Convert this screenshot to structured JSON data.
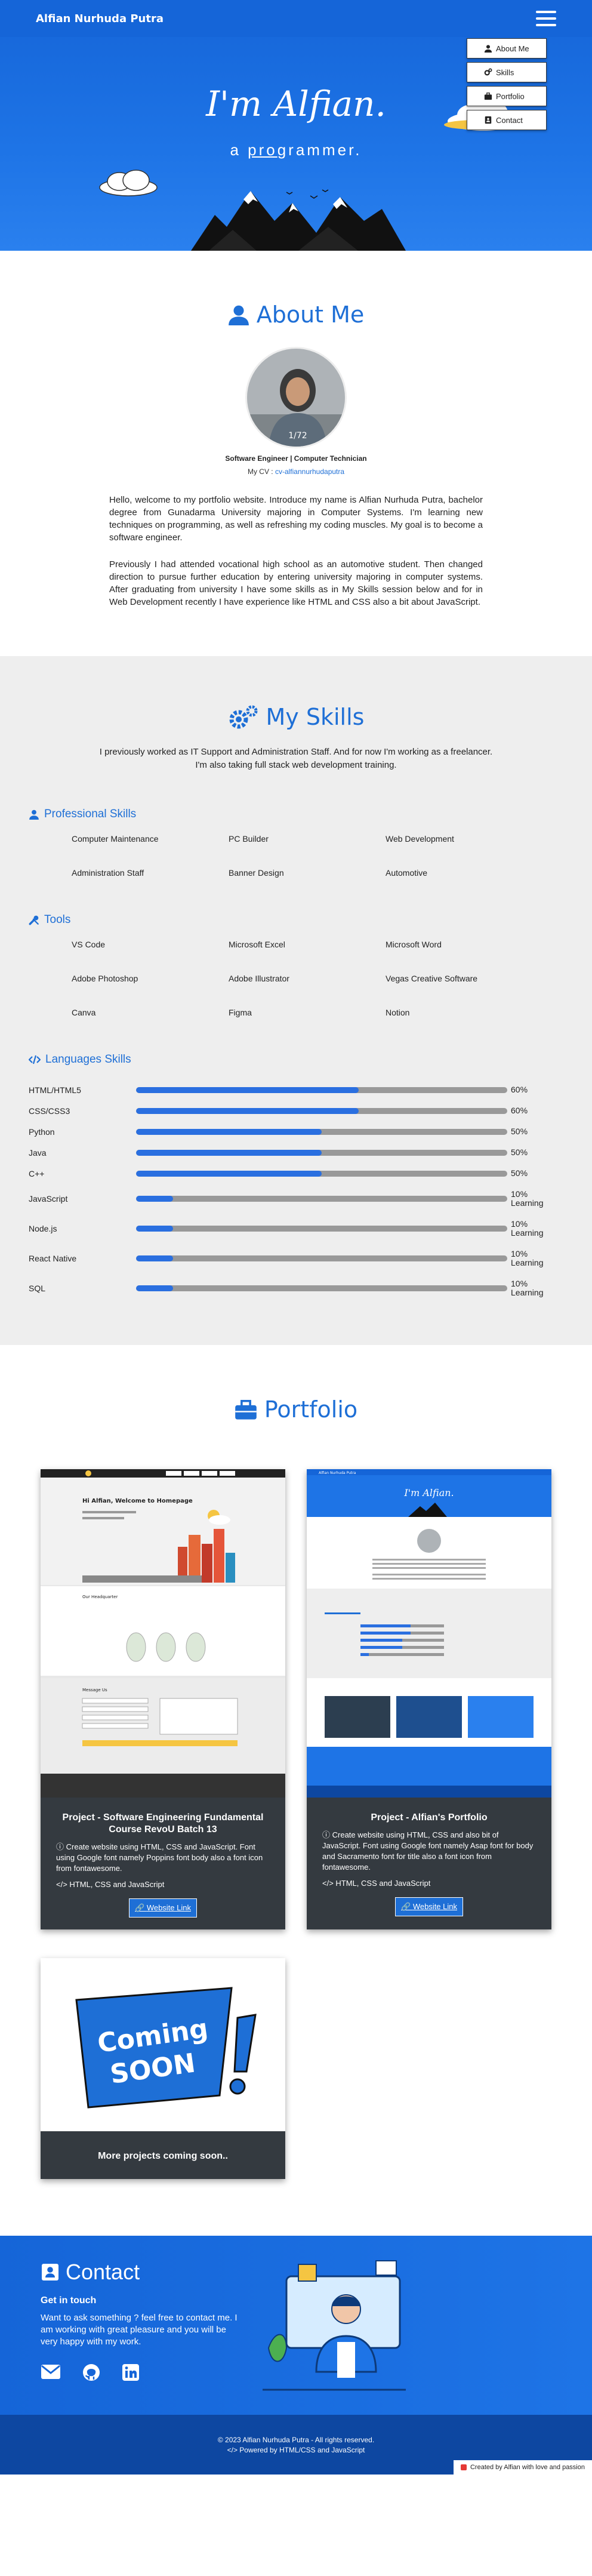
{
  "nav": {
    "brand": "Alfian Nurhuda Putra"
  },
  "menu": {
    "items": [
      {
        "label": "About Me",
        "icon": "user-icon"
      },
      {
        "label": "Skills",
        "icon": "gears-icon"
      },
      {
        "label": "Portfolio",
        "icon": "briefcase-icon"
      },
      {
        "label": "Contact",
        "icon": "contact-card-icon"
      }
    ]
  },
  "hero": {
    "title": "I'm Alfian.",
    "sub_prefix": "a ",
    "sub_underline": "pro",
    "sub_suffix": "grammer."
  },
  "about": {
    "title": "About Me",
    "role": "Software Engineer | Computer Technician",
    "cv_label": "My CV :",
    "cv_link": "cv-alfiannurhudaputra",
    "p1": "Hello, welcome to my portfolio website. Introduce my name is Alfian Nurhuda Putra, bachelor degree from Gunadarma University majoring in Computer Systems. I'm learning new techniques on programming, as well as refreshing my coding muscles. My goal is to become a software engineer.",
    "p2": "Previously I had attended vocational high school as an automotive student. Then changed direction to pursue further education by entering university majoring in computer systems. After graduating from university I have some skills as in My Skills session below and for in Web Development recently I have experience like HTML and CSS also a bit about JavaScript."
  },
  "skills": {
    "title": "My Skills",
    "intro1": "I previously worked as IT Support and Administration Staff. And for now I'm working as a freelancer.",
    "intro2": "I'm also taking full stack web development training.",
    "professional_title": "Professional Skills",
    "professional": [
      "Computer Maintenance",
      "PC Builder",
      "Web Development",
      "Administration Staff",
      "Banner Design",
      "Automotive"
    ],
    "tools_title": "Tools",
    "tools": [
      "VS Code",
      "Microsoft Excel",
      "Microsoft Word",
      "Adobe Photoshop",
      "Adobe Illustrator",
      "Vegas Creative Software",
      "Canva",
      "Figma",
      "Notion"
    ],
    "languages_title": "Languages Skills",
    "languages": [
      {
        "name": "HTML/HTML5",
        "level": 60,
        "label": "60%"
      },
      {
        "name": "CSS/CSS3",
        "level": 60,
        "label": "60%"
      },
      {
        "name": "Python",
        "level": 50,
        "label": "50%"
      },
      {
        "name": "Java",
        "level": 50,
        "label": "50%"
      },
      {
        "name": "C++",
        "level": 50,
        "label": "50%"
      },
      {
        "name": "JavaScript",
        "level": 10,
        "label": "10% Learning"
      },
      {
        "name": "Node.js",
        "level": 10,
        "label": "10% Learning"
      },
      {
        "name": "React Native",
        "level": 10,
        "label": "10% Learning"
      },
      {
        "name": "SQL",
        "level": 10,
        "label": "10% Learning"
      }
    ]
  },
  "portfolio": {
    "title": "Portfolio",
    "projects": [
      {
        "title": "Project - Software Engineering Fundamental Course RevoU Batch 13",
        "desc": "Create website using HTML, CSS and JavaScript. Font using Google font namely Poppins font body also a font icon from fontawesome.",
        "tech": "HTML, CSS and JavaScript",
        "button": "Website Link"
      },
      {
        "title": "Project - Alfian's Portfolio",
        "desc": "Create website using HTML, CSS and also bit of JavaScript. Font using Google font namely Asap font for body and Sacramento font for title also a font icon from fontawesome.",
        "tech": "HTML, CSS and JavaScript",
        "button": "Website Link"
      }
    ],
    "coming": {
      "title": "More projects coming soon..",
      "art_l1": "Coming",
      "art_l2": "SOON"
    },
    "shot1": {
      "headline": "Hi Alfian, Welcome to Homepage",
      "section": "Our Headquarter",
      "form": "Message Us"
    },
    "shot2": {
      "brand": "Alfian Nurhuda Putra"
    }
  },
  "contact": {
    "title": "Contact",
    "get": "Get in touch",
    "msg": "Want to ask something ? feel free to contact me. I am working with great pleasure and you will be very happy with my work."
  },
  "footer": {
    "copy": "© 2023 Alfian Nurhuda Putra - All rights reserved.",
    "powered": "Powered by HTML/CSS and JavaScript",
    "credit": "Created by Alfian with love and passion"
  }
}
